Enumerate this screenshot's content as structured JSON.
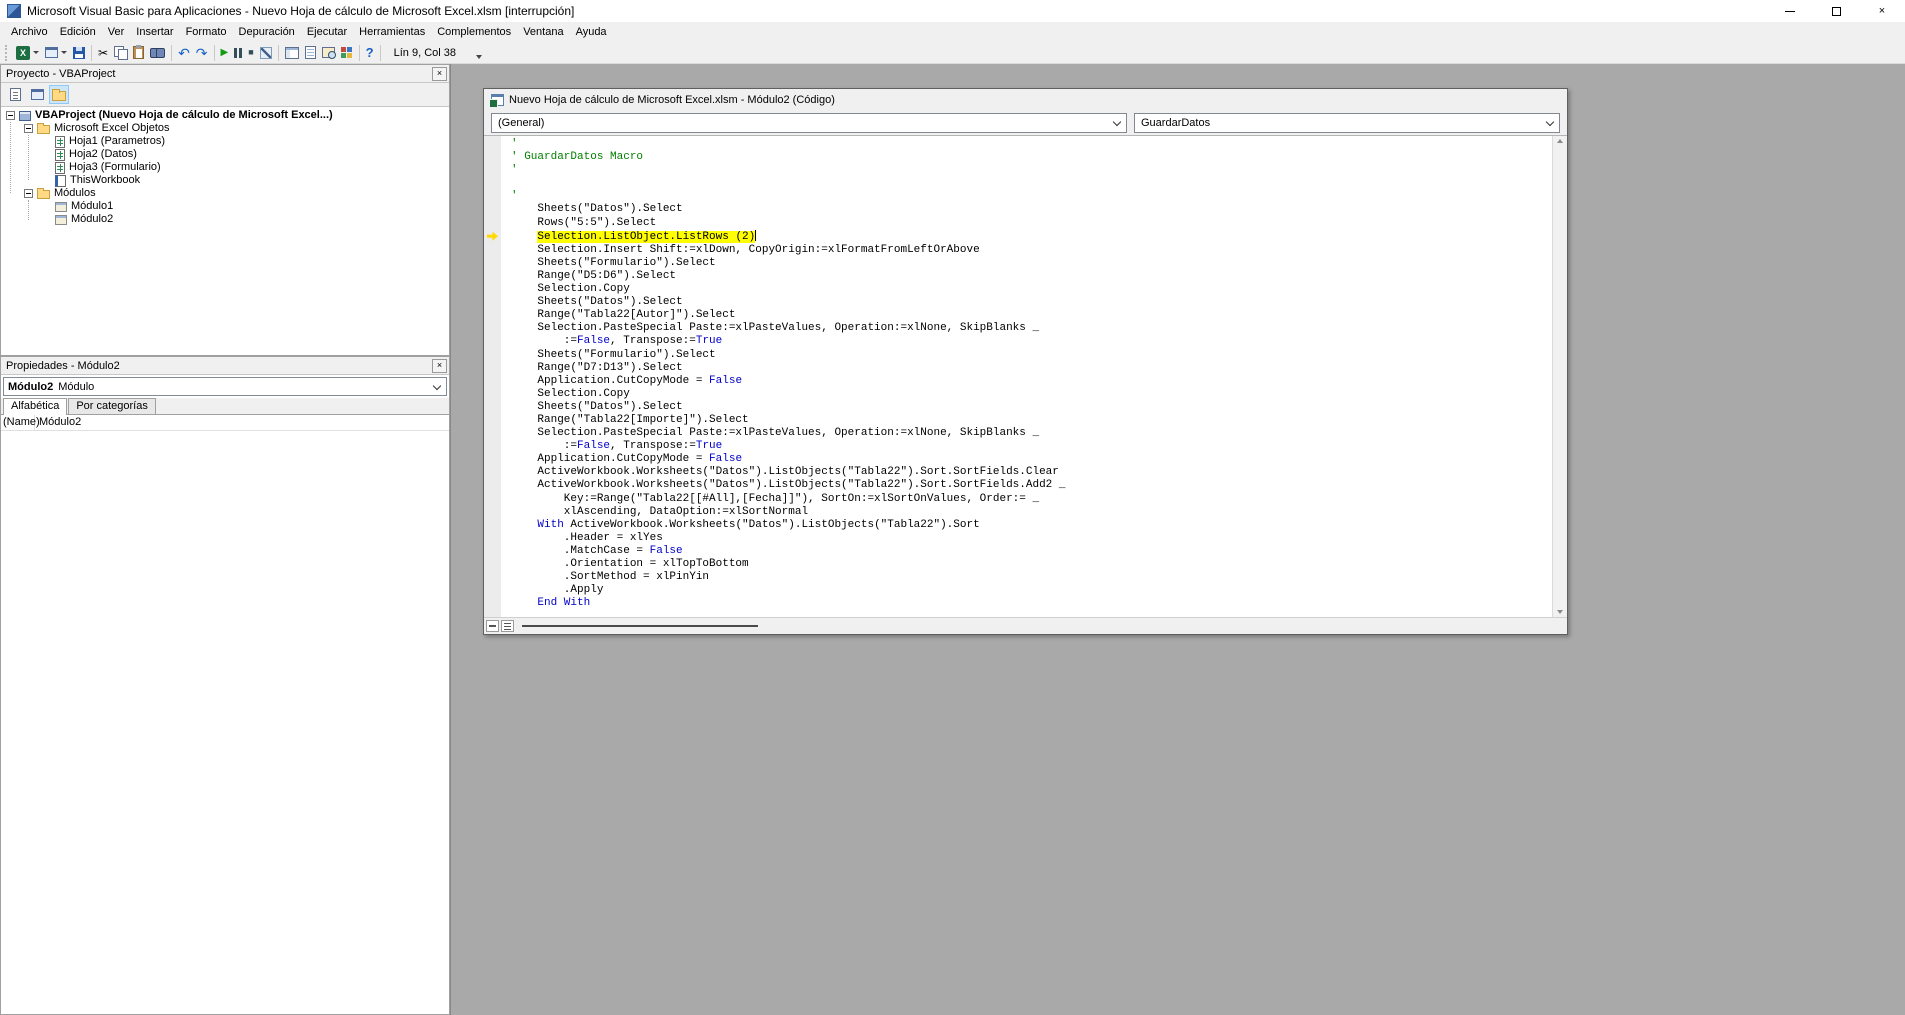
{
  "window": {
    "title": "Microsoft Visual Basic para Aplicaciones - Nuevo Hoja de cálculo de Microsoft Excel.xlsm [interrupción]"
  },
  "menu": {
    "items": [
      {
        "name": "archivo",
        "label": "Archivo"
      },
      {
        "name": "edicion",
        "label": "Edición"
      },
      {
        "name": "ver",
        "label": "Ver"
      },
      {
        "name": "insertar",
        "label": "Insertar"
      },
      {
        "name": "formato",
        "label": "Formato"
      },
      {
        "name": "depuracion",
        "label": "Depuración"
      },
      {
        "name": "ejecutar",
        "label": "Ejecutar"
      },
      {
        "name": "herramientas",
        "label": "Herramientas"
      },
      {
        "name": "complementos",
        "label": "Complementos"
      },
      {
        "name": "ventana",
        "label": "Ventana"
      },
      {
        "name": "ayuda",
        "label": "Ayuda"
      }
    ]
  },
  "toolbar": {
    "position_label": "Lín 9, Col 38",
    "buttons": [
      {
        "icon": "excel",
        "name": "view-microsoft-excel-button",
        "dropdown": true
      },
      {
        "icon": "userform",
        "name": "insert-userform-button",
        "dropdown": true
      },
      {
        "icon": "save",
        "name": "save-button"
      },
      {
        "sep": true
      },
      {
        "icon": "cut",
        "name": "cut-button"
      },
      {
        "icon": "copy",
        "name": "copy-button"
      },
      {
        "icon": "paste",
        "name": "paste-button"
      },
      {
        "icon": "find",
        "name": "find-button"
      },
      {
        "sep": true
      },
      {
        "icon": "undo",
        "name": "undo-button"
      },
      {
        "icon": "redo",
        "name": "redo-button"
      },
      {
        "sep": true
      },
      {
        "icon": "run",
        "name": "continue-button"
      },
      {
        "icon": "brk",
        "name": "break-button"
      },
      {
        "icon": "reset",
        "name": "reset-button"
      },
      {
        "icon": "design",
        "name": "design-mode-button"
      },
      {
        "sep": true
      },
      {
        "icon": "projexp",
        "name": "project-explorer-button"
      },
      {
        "icon": "props",
        "name": "properties-window-button"
      },
      {
        "icon": "objb",
        "name": "object-browser-button"
      },
      {
        "icon": "toolbox",
        "name": "toolbox-button"
      },
      {
        "sep": true
      },
      {
        "icon": "help",
        "name": "help-button"
      },
      {
        "sep": true
      }
    ]
  },
  "project_panel": {
    "title": "Proyecto - VBAProject",
    "close_glyph": "×",
    "toolbar": [
      {
        "icon": "viewcode",
        "name": "view-code-button"
      },
      {
        "icon": "viewobj",
        "name": "view-object-button"
      },
      {
        "icon": "folders",
        "name": "toggle-folders-button",
        "active": true
      }
    ],
    "tree": [
      {
        "name": "vbaproject-root",
        "label": "VBAProject (Nuevo Hoja de cálculo de Microsoft Excel...)",
        "icon": "project",
        "level": 0,
        "expander": true,
        "bold": true
      },
      {
        "name": "microsoft-excel-objetos",
        "label": "Microsoft Excel Objetos",
        "icon": "folder",
        "level": 1,
        "expander": true
      },
      {
        "name": "hoja1",
        "label": "Hoja1 (Parametros)",
        "icon": "sheet",
        "level": 2
      },
      {
        "name": "hoja2",
        "label": "Hoja2 (Datos)",
        "icon": "sheet",
        "level": 2
      },
      {
        "name": "hoja3",
        "label": "Hoja3 (Formulario)",
        "icon": "sheet",
        "level": 2
      },
      {
        "name": "thisworkbook",
        "label": "ThisWorkbook",
        "icon": "workbook",
        "level": 2
      },
      {
        "name": "modulos",
        "label": "Módulos",
        "icon": "folder",
        "level": 1,
        "expander": true
      },
      {
        "name": "modulo1",
        "label": "Módulo1",
        "icon": "module",
        "level": 2
      },
      {
        "name": "modulo2",
        "label": "Módulo2",
        "icon": "module",
        "level": 2
      }
    ]
  },
  "properties_panel": {
    "title": "Propiedades - Módulo2",
    "close_glyph": "×",
    "selector": {
      "object": "Módulo2",
      "type": "Módulo"
    },
    "tabs": [
      {
        "name": "alfabetica",
        "label": "Alfabética",
        "active": true
      },
      {
        "name": "por-categorias",
        "label": "Por categorías",
        "active": false
      }
    ],
    "rows": [
      {
        "prop": "(Name)",
        "value": "Módulo2"
      }
    ]
  },
  "code_window": {
    "title": "Nuevo Hoja de cálculo de Microsoft Excel.xlsm - Módulo2 (Código)",
    "object_combo": "(General)",
    "procedure_combo": "GuardarDatos",
    "lines": [
      {
        "s": [
          [
            "'",
            "c"
          ]
        ]
      },
      {
        "s": [
          [
            "' GuardarDatos Macro",
            "c"
          ]
        ]
      },
      {
        "s": [
          [
            "'",
            "c"
          ]
        ]
      },
      {
        "s": []
      },
      {
        "s": [
          [
            "'",
            "c"
          ]
        ]
      },
      {
        "s": [
          [
            "    Sheets(\"Datos\").Select",
            "p"
          ]
        ]
      },
      {
        "s": [
          [
            "    Rows(\"5:5\").Select",
            "p"
          ]
        ]
      },
      {
        "s": [
          [
            "    ",
            "p"
          ],
          [
            "Selection.ListObject.ListRows (2)",
            "h"
          ]
        ],
        "arrow": true,
        "caret": true
      },
      {
        "s": [
          [
            "    Selection.Insert Shift:=xlDown, CopyOrigin:=xlFormatFromLeftOrAbove",
            "p"
          ]
        ]
      },
      {
        "s": [
          [
            "    Sheets(\"Formulario\").Select",
            "p"
          ]
        ]
      },
      {
        "s": [
          [
            "    Range(\"D5:D6\").Select",
            "p"
          ]
        ]
      },
      {
        "s": [
          [
            "    Selection.Copy",
            "p"
          ]
        ]
      },
      {
        "s": [
          [
            "    Sheets(\"Datos\").Select",
            "p"
          ]
        ]
      },
      {
        "s": [
          [
            "    Range(\"Tabla22[Autor]\").Select",
            "p"
          ]
        ]
      },
      {
        "s": [
          [
            "    Selection.PasteSpecial Paste:=xlPasteValues, Operation:=xlNone, SkipBlanks _",
            "p"
          ]
        ]
      },
      {
        "s": [
          [
            "        :=",
            "p"
          ],
          [
            "False",
            "k"
          ],
          [
            ", Transpose:=",
            "p"
          ],
          [
            "True",
            "k"
          ]
        ]
      },
      {
        "s": [
          [
            "    Sheets(\"Formulario\").Select",
            "p"
          ]
        ]
      },
      {
        "s": [
          [
            "    Range(\"D7:D13\").Select",
            "p"
          ]
        ]
      },
      {
        "s": [
          [
            "    Application.CutCopyMode = ",
            "p"
          ],
          [
            "False",
            "k"
          ]
        ]
      },
      {
        "s": [
          [
            "    Selection.Copy",
            "p"
          ]
        ]
      },
      {
        "s": [
          [
            "    Sheets(\"Datos\").Select",
            "p"
          ]
        ]
      },
      {
        "s": [
          [
            "    Range(\"Tabla22[Importe]\").Select",
            "p"
          ]
        ]
      },
      {
        "s": [
          [
            "    Selection.PasteSpecial Paste:=xlPasteValues, Operation:=xlNone, SkipBlanks _",
            "p"
          ]
        ]
      },
      {
        "s": [
          [
            "        :=",
            "p"
          ],
          [
            "False",
            "k"
          ],
          [
            ", Transpose:=",
            "p"
          ],
          [
            "True",
            "k"
          ]
        ]
      },
      {
        "s": [
          [
            "    Application.CutCopyMode = ",
            "p"
          ],
          [
            "False",
            "k"
          ]
        ]
      },
      {
        "s": [
          [
            "    ActiveWorkbook.Worksheets(\"Datos\").ListObjects(\"Tabla22\").Sort.SortFields.Clear",
            "p"
          ]
        ]
      },
      {
        "s": [
          [
            "    ActiveWorkbook.Worksheets(\"Datos\").ListObjects(\"Tabla22\").Sort.SortFields.Add2 _",
            "p"
          ]
        ]
      },
      {
        "s": [
          [
            "        Key:=Range(\"Tabla22[[#All],[Fecha]]\"), SortOn:=xlSortOnValues, Order:= _",
            "p"
          ]
        ]
      },
      {
        "s": [
          [
            "        xlAscending, DataOption:=xlSortNormal",
            "p"
          ]
        ]
      },
      {
        "s": [
          [
            "    ",
            "p"
          ],
          [
            "With",
            "k"
          ],
          [
            " ActiveWorkbook.Worksheets(\"Datos\").ListObjects(\"Tabla22\").Sort",
            "p"
          ]
        ]
      },
      {
        "s": [
          [
            "        .Header = xlYes",
            "p"
          ]
        ]
      },
      {
        "s": [
          [
            "        .MatchCase = ",
            "p"
          ],
          [
            "False",
            "k"
          ]
        ]
      },
      {
        "s": [
          [
            "        .Orientation = xlTopToBottom",
            "p"
          ]
        ]
      },
      {
        "s": [
          [
            "        .SortMethod = xlPinYin",
            "p"
          ]
        ]
      },
      {
        "s": [
          [
            "        .Apply",
            "p"
          ]
        ]
      },
      {
        "s": [
          [
            "    ",
            "p"
          ],
          [
            "End With",
            "k"
          ]
        ]
      }
    ]
  },
  "colors": {
    "mdi_background": "#a9a9a9",
    "execution_highlight": "#ffff00",
    "comment_green": "#008000",
    "keyword_blue": "#0000c8",
    "titlebar": "#ffffff"
  }
}
